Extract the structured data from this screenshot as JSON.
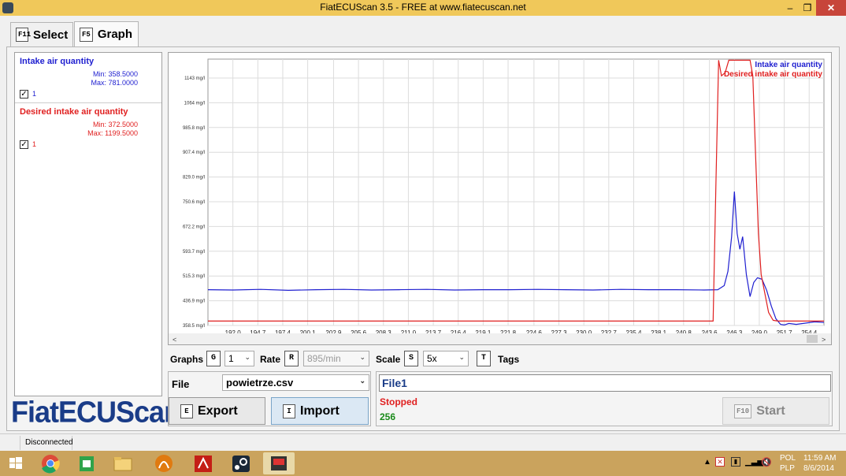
{
  "window": {
    "title": "FiatECUScan 3.5 - FREE at www.fiatecuscan.net",
    "minimize": "–",
    "maximize": "❐",
    "close": "✕"
  },
  "tabs": [
    {
      "key": "F11",
      "label": "Select"
    },
    {
      "key": "F5",
      "label": "Graph"
    }
  ],
  "channels": [
    {
      "name": "Intake air quantity",
      "min": "Min: 358.5000",
      "max": "Max: 781.0000",
      "checked": "✓",
      "graph": "1",
      "color": "#1f1fd0"
    },
    {
      "name": "Desired intake air quantity",
      "min": "Min: 372.5000",
      "max": "Max: 1199.5000",
      "checked": "✓",
      "graph": "1",
      "color": "#e02020"
    }
  ],
  "logo": "FiatECUScan",
  "chart_data": {
    "type": "line",
    "y_ticks": [
      "1143 mg/l",
      "1064 mg/l",
      "985.8 mg/l",
      "907.4 mg/l",
      "829.0 mg/l",
      "750.6 mg/l",
      "672.2 mg/l",
      "593.7 mg/l",
      "515.3 mg/l",
      "436.9 mg/l",
      "358.5 mg/l"
    ],
    "x_ticks": [
      "192.0",
      "194.7",
      "197.4",
      "200.1",
      "202.9",
      "205.6",
      "208.3",
      "211.0",
      "213.7",
      "216.4",
      "219.1",
      "221.8",
      "224.6",
      "227.3",
      "230.0",
      "232.7",
      "235.4",
      "238.1",
      "240.8",
      "243.6",
      "246.3",
      "249.0",
      "251.7",
      "254.4"
    ],
    "ylim": [
      358.5,
      1143
    ],
    "xlim": [
      189.3,
      256.0
    ],
    "legend_position": "top-right",
    "grid": true,
    "series": [
      {
        "name": "Intake air quantity",
        "color": "#1f1fd0",
        "x": [
          189.3,
          192,
          195,
          198,
          201,
          204,
          207,
          210,
          213,
          216,
          219,
          222,
          225,
          228,
          231,
          234,
          237,
          240,
          243,
          244.5,
          245.2,
          245.6,
          246.0,
          246.3,
          246.6,
          246.9,
          247.2,
          247.6,
          248.0,
          248.4,
          248.8,
          249.3,
          249.8,
          250.3,
          250.8,
          251.3,
          251.7,
          252.2,
          253,
          254,
          255,
          256
        ],
        "y": [
          472,
          471,
          473,
          470,
          472,
          473,
          471,
          472,
          473,
          471,
          472,
          472,
          473,
          472,
          471,
          473,
          472,
          472,
          471,
          472,
          485,
          530,
          640,
          783,
          650,
          600,
          640,
          520,
          450,
          495,
          510,
          505,
          470,
          420,
          380,
          362,
          360,
          365,
          362,
          366,
          370,
          368
        ]
      },
      {
        "name": "Desired intake air quantity",
        "color": "#e02020",
        "x": [
          189.3,
          195,
          200,
          205,
          210,
          215,
          220,
          225,
          230,
          235,
          240,
          244.0,
          244.3,
          244.6,
          244.9,
          245.3,
          245.7,
          246.1,
          246.5,
          247.0,
          247.5,
          248.0,
          248.3,
          248.6,
          248.9,
          249.2,
          249.6,
          250.0,
          250.5,
          251.0,
          252,
          253,
          254,
          255,
          256
        ],
        "y": [
          372.5,
          372.5,
          372.5,
          372.5,
          372.5,
          372.5,
          372.5,
          372.5,
          372.5,
          372.5,
          372.5,
          372.5,
          800,
          1199.5,
          1150,
          1160,
          1199.5,
          1199.5,
          1199.5,
          1199.5,
          1199.5,
          1199.5,
          1150,
          900,
          650,
          520,
          460,
          400,
          375,
          372.5,
          372.5,
          372.5,
          372.5,
          372.5,
          372.5
        ]
      }
    ]
  },
  "controls": {
    "graphs_label": "Graphs",
    "graphs_key": "G",
    "graphs_value": "1",
    "rate_label": "Rate",
    "rate_key": "R",
    "rate_value": "895/min",
    "scale_label": "Scale",
    "scale_key": "S",
    "scale_value": "5x",
    "tags_key": "T",
    "tags_label": "Tags",
    "file_label": "File",
    "file_value": "powietrze.csv",
    "export_key": "E",
    "export_label": "Export",
    "import_key": "I",
    "import_label": "Import",
    "filename_display": "File1",
    "status": "Stopped",
    "count": "256",
    "start_key": "F10",
    "start_label": "Start"
  },
  "statusbar": {
    "connection": "Disconnected"
  },
  "taskbar": {
    "icons": [
      "windows-start-icon",
      "chrome-icon",
      "store-icon",
      "file-explorer-icon",
      "orange-app-icon",
      "acrobat-icon",
      "steam-icon",
      "fiatecuscan-icon"
    ],
    "lang": "POL",
    "kbd": "PLP",
    "time": "11:59 AM",
    "date": "8/6/2014"
  },
  "colors": {
    "titlebar": "#f0c85a",
    "taskbar": "#caa35d",
    "blue": "#1f1fd0",
    "red": "#e02020",
    "green": "#1a8a1a"
  }
}
